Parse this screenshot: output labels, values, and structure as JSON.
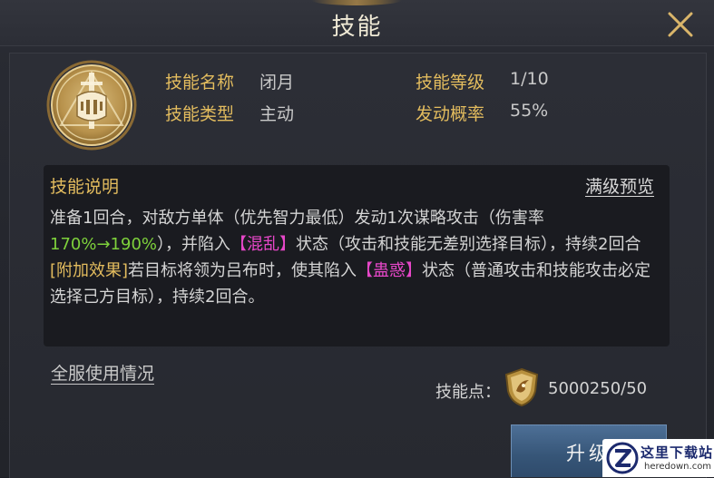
{
  "header": {
    "title": "技能"
  },
  "skill": {
    "name_label": "技能名称",
    "name_value": "闭月",
    "type_label": "技能类型",
    "type_value": "主动",
    "level_label": "技能等级",
    "level_value": "1/10",
    "chance_label": "发动概率",
    "chance_value": "55%"
  },
  "description": {
    "header": "技能说明",
    "max_preview_link": "满级预览",
    "line1_prefix": "准备1回合，对敌方单体（优先智力最低）发动1次谋略攻击（伤害率",
    "damage_rate": "170%→190%",
    "line2_mid": "），并陷入",
    "status1": "【混乱】",
    "line2_suffix": "状态（攻击和技能无差别选择目标），持续2回合",
    "extra_tag": "[附加效果]",
    "extra_mid": "若目标将领为吕布时，使其陷入",
    "status2": "【蛊惑】",
    "extra_suffix": "状态（普通攻击和技能攻击必定选择己方目标），持续2回合。"
  },
  "footer": {
    "usage_link": "全服使用情况",
    "points_label": "技能点：",
    "points_value": "5000250/50",
    "upgrade_button": "升级"
  },
  "watermark": {
    "title": "这里下载站",
    "subtitle": "heredown.com"
  },
  "icons": {
    "close": "close-icon",
    "emblem": "helmet-sword-emblem-icon",
    "points": "shield-skill-point-icon"
  },
  "colors": {
    "gold": "#e3bc5e",
    "green": "#7ed13b",
    "pink": "#e647c8",
    "button_blue": "#365577"
  }
}
